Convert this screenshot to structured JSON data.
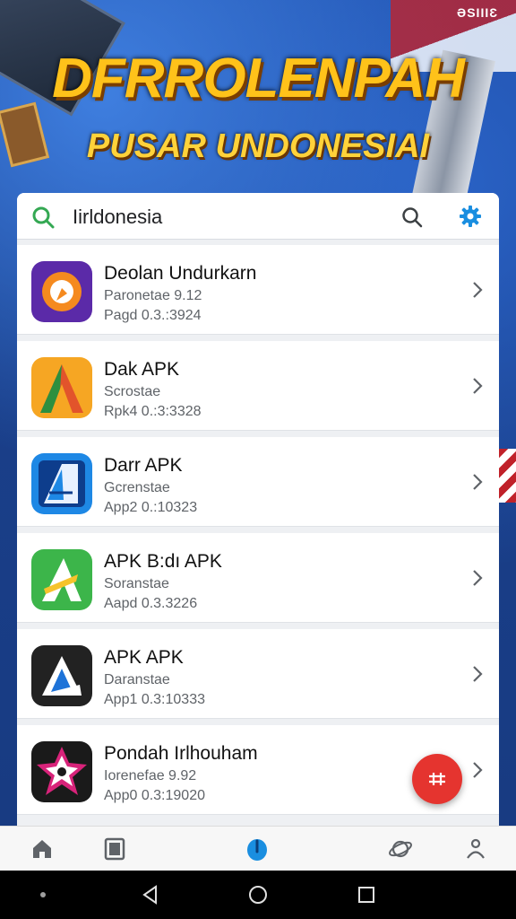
{
  "banner": {
    "headline": "DFRROLENPAH",
    "subheadline": "PUSAR UNDONESIAI",
    "badge": "ƏSIIIƐ"
  },
  "search": {
    "query": "Iirldonesia"
  },
  "apps": [
    {
      "title": "Deolan Undurkarn",
      "line1": "Paronetae 9.12",
      "line2": "Pagd 0.3.:3924",
      "icon": "app-icon-orange-chat",
      "colors": [
        "#5b2aa8",
        "#f58a1f"
      ]
    },
    {
      "title": "Dak APK",
      "line1": "Scrostae",
      "line2": "Rpk4 0.:3:3328",
      "icon": "app-icon-letter-a-gradient",
      "colors": [
        "#f6a623",
        "#e2542b"
      ]
    },
    {
      "title": "Darr APK",
      "line1": "Gcrenstae",
      "line2": "App2 0.:10323",
      "icon": "app-icon-blue-book",
      "colors": [
        "#1e88e5",
        "#0d3d8c"
      ]
    },
    {
      "title": "APK B:dı APK",
      "line1": "Soranstae",
      "line2": "Aapd 0.3.3226",
      "icon": "app-icon-green-a",
      "colors": [
        "#3cb54a",
        "#1b8a2e"
      ]
    },
    {
      "title": "APK APK",
      "line1": "Daranstae",
      "line2": "App1 0.3:10333",
      "icon": "app-icon-dark-a",
      "colors": [
        "#222222",
        "#1e73d8"
      ]
    },
    {
      "title": "Pondah Irlhouham",
      "line1": "Iorenefae 9.92",
      "line2": "App0 0.3:19020",
      "icon": "app-icon-star-burst",
      "colors": [
        "#1a1a1a",
        "#d8237a"
      ]
    }
  ],
  "fab": {
    "icon": "grid-add-icon",
    "color": "#e5342f"
  },
  "bottom_nav": [
    "home-icon",
    "book-icon",
    "compass-icon",
    "planet-icon",
    "person-icon"
  ],
  "accent": "#1a8ee0"
}
